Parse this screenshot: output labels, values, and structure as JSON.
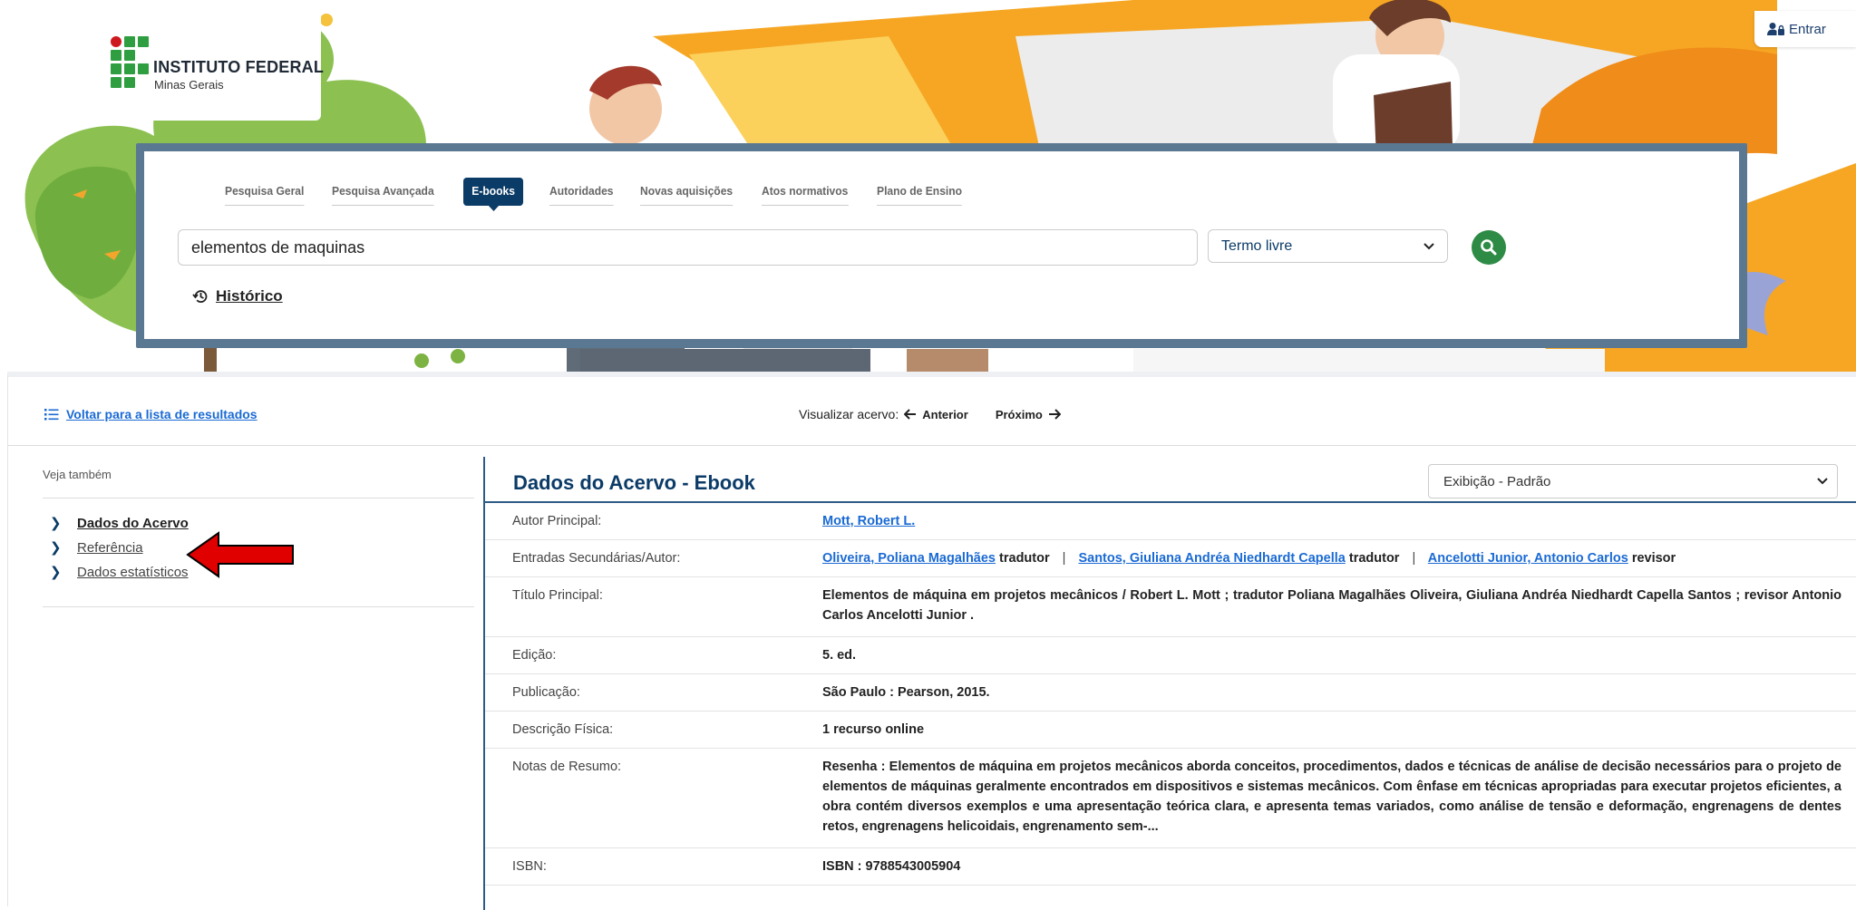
{
  "header": {
    "logo_title": "INSTITUTO FEDERAL",
    "logo_subtitle": "Minas Gerais",
    "login_label": "Entrar"
  },
  "search": {
    "tabs": [
      {
        "label": "Pesquisa Geral",
        "active": false
      },
      {
        "label": "Pesquisa Avançada",
        "active": false
      },
      {
        "label": "E-books",
        "active": true
      },
      {
        "label": "Autoridades",
        "active": false
      },
      {
        "label": "Novas aquisições",
        "active": false
      },
      {
        "label": "Atos normativos",
        "active": false
      },
      {
        "label": "Plano de Ensino",
        "active": false
      }
    ],
    "query_value": "elementos de maquinas",
    "field_select": "Termo livre",
    "history_label": "Histórico"
  },
  "toolbar": {
    "back_label": "Voltar para a lista de resultados",
    "view_label": "Visualizar acervo:",
    "prev_label": "Anterior",
    "next_label": "Próximo"
  },
  "sidebar": {
    "title": "Veja também",
    "items": [
      {
        "label": "Dados do Acervo"
      },
      {
        "label": "Referência"
      },
      {
        "label": "Dados estatísticos"
      }
    ]
  },
  "detail": {
    "title": "Dados do Acervo - Ebook",
    "display_select": "Exibição - Padrão",
    "autor_label": "Autor Principal:",
    "autor_value": "Mott, Robert L.",
    "entradas_label": "Entradas Secundárias/Autor:",
    "entradas": [
      {
        "name": "Oliveira, Poliana Magalhães",
        "role": "tradutor"
      },
      {
        "name": "Santos, Giuliana Andréa Niedhardt Capella",
        "role": "tradutor"
      },
      {
        "name": "Ancelotti Junior, Antonio Carlos",
        "role": "revisor"
      }
    ],
    "titulo_label": "Título Principal:",
    "titulo_value": "Elementos de máquina em projetos mecânicos / Robert L. Mott ; tradutor Poliana Magalhães Oliveira, Giuliana Andréa Niedhardt Capella Santos ; revisor Antonio Carlos Ancelotti Junior .",
    "edicao_label": "Edição:",
    "edicao_value": "5. ed.",
    "publicacao_label": "Publicação:",
    "publicacao_value": "São Paulo : Pearson, 2015.",
    "descricao_label": "Descrição Física:",
    "descricao_value": "1 recurso online",
    "notas_label": "Notas de Resumo:",
    "notas_value": "Resenha : Elementos de máquina em projetos mecânicos aborda conceitos, procedimentos, dados e técnicas de análise de decisão necessários para o projeto de elementos de máquinas geralmente encontrados em dispositivos e sistemas mecânicos. Com ênfase em técnicas apropriadas para executar projetos eficientes, a obra contém diversos exemplos e uma apresentação teórica clara, e apresenta temas variados, como análise de tensão e deformação, engrenagens de dentes retos, engrenagens helicoidais, engrenamento sem-...",
    "isbn_label": "ISBN:",
    "isbn_value": "ISBN : 9788543005904"
  },
  "colors": {
    "primary": "#0b3b67",
    "link": "#1a6ad4",
    "search_button": "#2e8b46",
    "frame": "#5b7893",
    "illustration_orange": "#f6a623",
    "illustration_green": "#7cb342",
    "annotation_arrow": "#e00000"
  }
}
